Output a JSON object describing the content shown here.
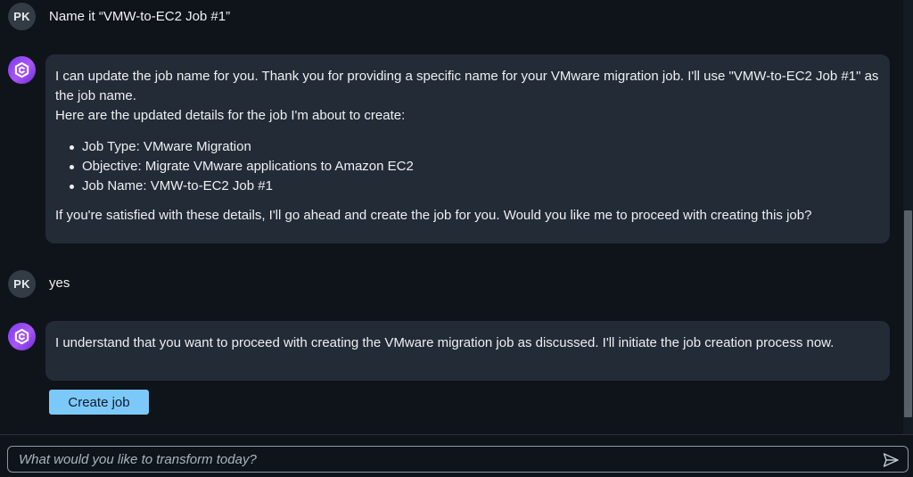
{
  "messages": [
    {
      "role": "user",
      "avatar": "PK",
      "text": "Name it “VMW-to-EC2 Job #1”"
    },
    {
      "role": "assistant",
      "avatar_icon": "assistant-logo-icon",
      "intro": "I can update the job name for you. Thank you for providing a specific name for your VMware migration job. I'll use \"VMW-to-EC2 Job #1\" as the job name.",
      "lead": "Here are the updated details for the job I'm about to create:",
      "items": [
        "Job Type: VMware Migration",
        "Objective: Migrate VMware applications to Amazon EC2",
        "Job Name: VMW-to-EC2 Job #1"
      ],
      "outro": "If you're satisfied with these details, I'll go ahead and create the job for you. Would you like me to proceed with creating this job?"
    },
    {
      "role": "user",
      "avatar": "PK",
      "text": "yes"
    },
    {
      "role": "assistant",
      "avatar_icon": "assistant-logo-icon",
      "text": "I understand that you want to proceed with creating the VMware migration job as discussed. I'll initiate the job creation process now."
    }
  ],
  "actions": {
    "create_job_label": "Create job"
  },
  "composer": {
    "placeholder": "What would you like to transform today?",
    "value": "",
    "send_icon": "send-icon"
  },
  "colors": {
    "background": "#0f141a",
    "bubble": "#232b37",
    "accent_button": "#7cc9f9",
    "avatar_user": "#333b45",
    "avatar_bot": "#8b45f2"
  }
}
